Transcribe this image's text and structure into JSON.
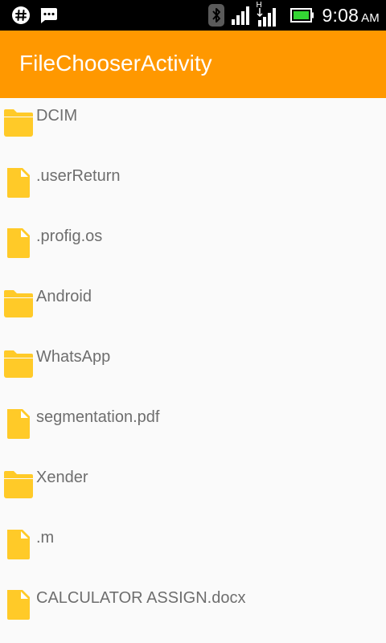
{
  "status_bar": {
    "time": "9:08",
    "ampm": "AM",
    "network_type": "H"
  },
  "app_bar": {
    "title": "FileChooserActivity",
    "color": "#ff9800"
  },
  "files": [
    {
      "name": "DCIM",
      "type": "folder",
      "icon": "folder-icon"
    },
    {
      "name": ".userReturn",
      "type": "file",
      "icon": "file-icon"
    },
    {
      "name": ".profig.os",
      "type": "file",
      "icon": "file-icon"
    },
    {
      "name": "Android",
      "type": "folder",
      "icon": "folder-icon"
    },
    {
      "name": "WhatsApp",
      "type": "folder",
      "icon": "folder-icon"
    },
    {
      "name": "segmentation.pdf",
      "type": "file",
      "icon": "file-icon"
    },
    {
      "name": "Xender",
      "type": "folder",
      "icon": "folder-icon"
    },
    {
      "name": ".m",
      "type": "file",
      "icon": "file-icon"
    },
    {
      "name": "CALCULATOR ASSIGN.docx",
      "type": "file",
      "icon": "file-icon"
    }
  ],
  "colors": {
    "icon_fill": "#ffca28",
    "label_text": "#6e6e6e",
    "background": "#fafafa"
  }
}
